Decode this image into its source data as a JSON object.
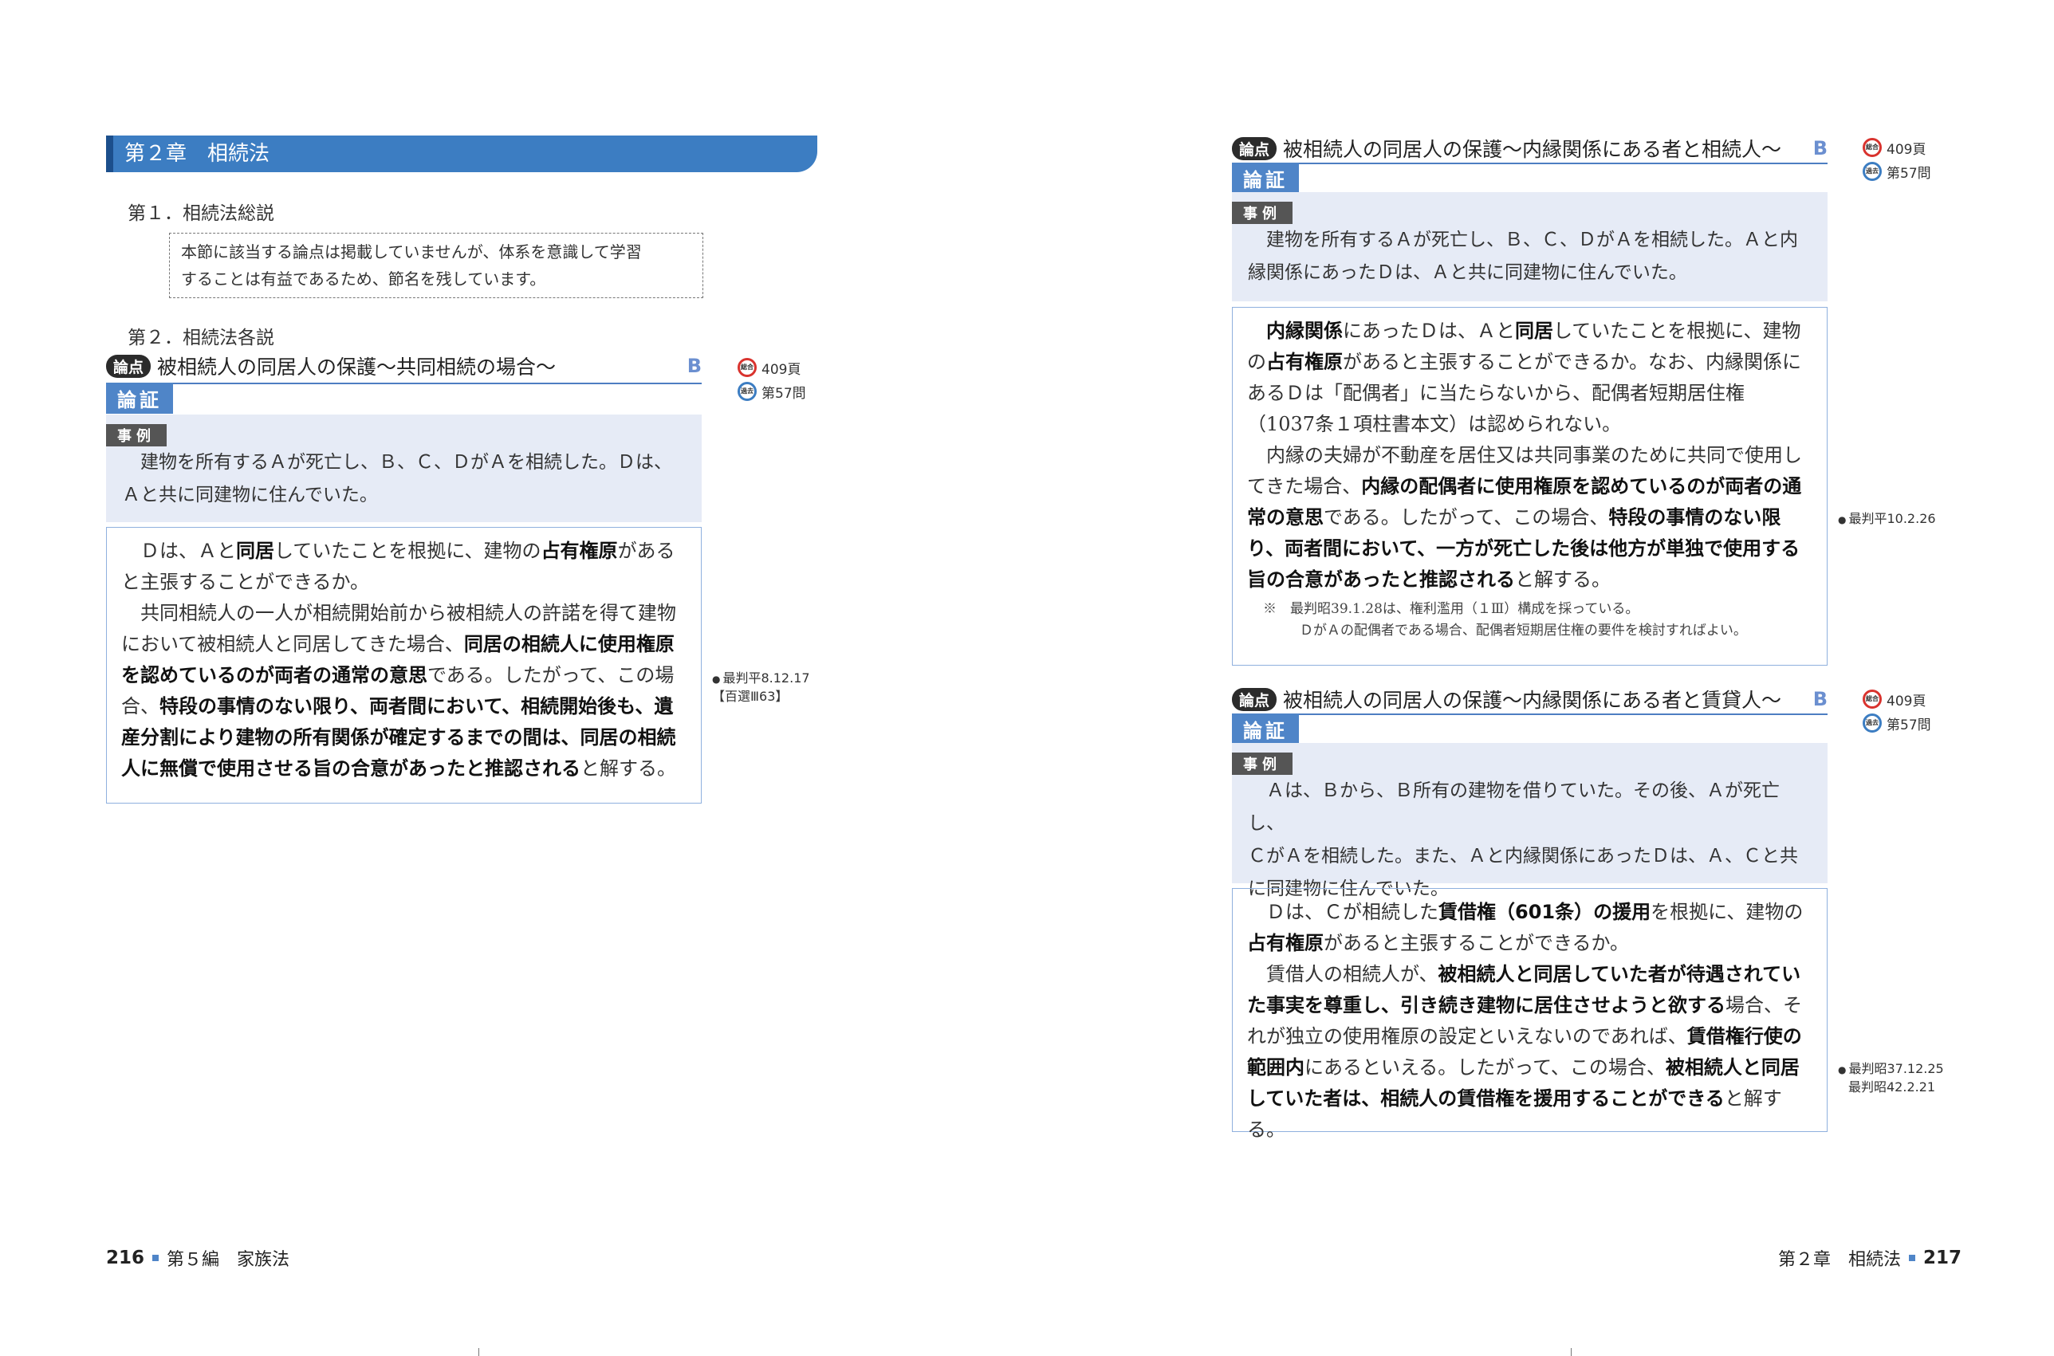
{
  "chapter": {
    "title": "第２章　相続法"
  },
  "sec1": {
    "heading": "第１．相続法総説",
    "note": [
      "本節に該当する論点は掲載していませんが、体系を意識して学習",
      "することは有益であるため、節名を残しています。"
    ]
  },
  "sec2": {
    "heading": "第２．相続法各説"
  },
  "labels": {
    "ronten": "論点",
    "ronsho": "論証",
    "jirei": "事例",
    "icon_sougou": "総合",
    "icon_kako": "過去"
  },
  "issue1": {
    "title": "被相続人の同居人の保護〜共同相続の場合〜",
    "rank": "B",
    "ref_page": "409頁",
    "ref_question": "第57問",
    "case": [
      "建物を所有するＡが死亡し、Ｂ、Ｃ、ＤがＡを相続した。Ｄは、",
      "Ａと共に同建物に住んでいた。"
    ],
    "arg": {
      "p1": [
        "Ｄは、Ａと",
        "同居",
        "していたことを根拠に、建物の",
        "占有権原",
        "があると主張することができるか。"
      ],
      "p2": [
        "共同相続人の一人が相続開始前から被相続人の許諾を得て建物において被相続人と同居してきた場合、",
        "同居の相続人に使用権原を認めているのが両者の通常の意思",
        "である。したがって、この場合、",
        "特段の事情のない限り、両者間において、相続開始後も、遺産分割により建物の所有関係が確定するまでの間は、同居の相続人に無償で使用させる旨の合意があったと推認される",
        "と解する。"
      ]
    },
    "margin": [
      "最判平8.12.17",
      "【百選Ⅲ63】"
    ]
  },
  "issue2": {
    "title": "被相続人の同居人の保護〜内縁関係にある者と相続人〜",
    "rank": "B",
    "ref_page": "409頁",
    "ref_question": "第57問",
    "case": [
      "建物を所有するＡが死亡し、Ｂ、Ｃ、ＤがＡを相続した。Ａと内",
      "縁関係にあったＤは、Ａと共に同建物に住んでいた。"
    ],
    "arg": {
      "p1": [
        "内縁関係",
        "にあったＤは、Ａと",
        "同居",
        "していたことを根拠に、建物の",
        "占有権原",
        "があると主張することができるか。なお、内縁関係にあるＤは「配偶者」に当たらないから、配偶者短期居住権（1037条１項柱書本文）は認められない。"
      ],
      "p2": [
        "内縁の夫婦が不動産を居住又は共同事業のために共同で使用してきた場合、",
        "内縁の配偶者に使用権原を認めているのが両者の通常の意思",
        "である。したがって、この場合、",
        "特段の事情のない限り、両者間において、一方が死亡した後は他方が単独で使用する旨の合意があったと推認される",
        "と解する。"
      ]
    },
    "notes": [
      "※　最判昭39.1.28は、権利濫用（１Ⅲ）構成を採っている。",
      "ＤがＡの配偶者である場合、配偶者短期居住権の要件を検討すればよい。"
    ],
    "margin": [
      "最判平10.2.26"
    ]
  },
  "issue3": {
    "title": "被相続人の同居人の保護〜内縁関係にある者と賃貸人〜",
    "rank": "B",
    "ref_page": "409頁",
    "ref_question": "第57問",
    "case": [
      "Ａは、Ｂから、Ｂ所有の建物を借りていた。その後、Ａが死亡し、",
      "ＣがＡを相続した。また、Ａと内縁関係にあったＤは、Ａ、Ｃと共",
      "に同建物に住んでいた。"
    ],
    "arg": {
      "p1": [
        "Ｄは、Ｃが相続した",
        "賃借権（601条）の援用",
        "を根拠に、建物の",
        "占有権原",
        "があると主張することができるか。"
      ],
      "p2": [
        "賃借人の相続人が、",
        "被相続人と同居していた者が待遇されていた事実を尊重し、引き続き建物に居住させようと欲する",
        "場合、それが独立の使用権原の設定といえないのであれば、",
        "賃借権行使の範囲内",
        "にあるといえる。したがって、この場合、",
        "被相続人と同居していた者は、相続人の賃借権を援用することができる",
        "と解する。"
      ]
    },
    "margin": [
      "最判昭37.12.25",
      "最判昭42.2.21"
    ]
  },
  "footer": {
    "left_page": "216",
    "left_text": "第５編　家族法",
    "right_text": "第２章　相続法",
    "right_page": "217"
  }
}
